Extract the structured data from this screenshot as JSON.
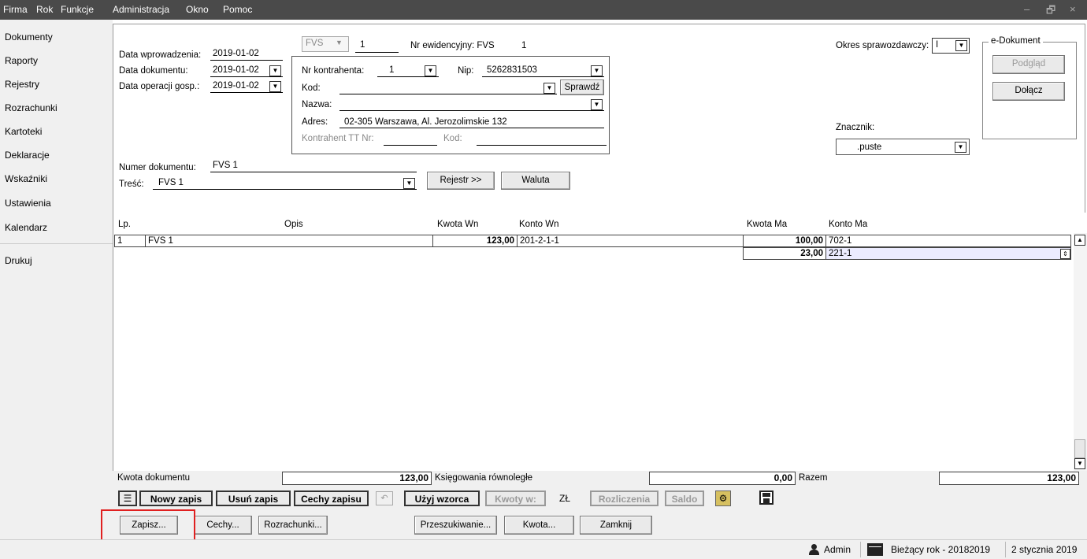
{
  "menu": [
    "Firma",
    "Rok",
    "Funkcje",
    "Administracja",
    "Okno",
    "Pomoc"
  ],
  "window_controls": {
    "minimize": "–",
    "restore": "🗗",
    "close": "×"
  },
  "sidebar": [
    "Dokumenty",
    "Raporty",
    "Rejestry",
    "Rozrachunki",
    "Kartoteki",
    "Deklaracje",
    "Wskaźniki",
    "Ustawienia",
    "Kalendarz",
    "Drukuj"
  ],
  "header": {
    "data_wprowadzenia_label": "Data wprowadzenia:",
    "data_wprowadzenia": "2019-01-02",
    "data_dokumentu_label": "Data dokumentu:",
    "data_dokumentu": "2019-01-02",
    "data_operacji_label": "Data operacji gosp.:",
    "data_operacji": "2019-01-02",
    "doc_type": "FVS",
    "doc_no": "1",
    "nr_ewid_label": "Nr ewidencyjny: FVS",
    "nr_ewid": "1",
    "okres_label": "Okres sprawozdawczy:",
    "okres": "I",
    "nr_kontrahenta_label": "Nr kontrahenta:",
    "nr_kontrahenta": "1",
    "nip_label": "Nip:",
    "nip": "5262831503",
    "kod_label": "Kod:",
    "sprawdz": "Sprawdź",
    "nazwa_label": "Nazwa:",
    "adres_label": "Adres:",
    "adres": "02-305 Warszawa, Al. Jerozolimskie 132",
    "kontrahent_tt_label": "Kontrahent TT Nr:",
    "kod2_label": "Kod:",
    "numer_dok_label": "Numer dokumentu:",
    "numer_dok": "FVS 1",
    "tresc_label": "Treść:",
    "tresc": "FVS 1",
    "rejestr_btn": "Rejestr >>",
    "waluta_btn": "Waluta",
    "znacznik_label": "Znacznik:",
    "znacznik": ".puste",
    "edok_label": "e-Dokument",
    "podglad": "Podgląd",
    "dolacz": "Dołącz"
  },
  "grid": {
    "headers": {
      "lp": "Lp.",
      "opis": "Opis",
      "kwota_wn": "Kwota Wn",
      "konto_wn": "Konto Wn",
      "kwota_ma": "Kwota Ma",
      "konto_ma": "Konto Ma"
    },
    "rows": [
      {
        "lp": "1",
        "opis": "FVS 1",
        "kwota_wn": "123,00",
        "konto_wn": "201-2-1-1",
        "kwota_ma": "100,00",
        "konto_ma": "702-1"
      },
      {
        "lp": "",
        "opis": "",
        "kwota_wn": "",
        "konto_wn": "",
        "kwota_ma": "23,00",
        "konto_ma": "221-1"
      }
    ]
  },
  "totals": {
    "kwota_dok_label": "Kwota dokumentu",
    "kwota_dok": "123,00",
    "ksieg_label": "Księgowania równoległe",
    "ksieg": "0,00",
    "razem_label": "Razem",
    "razem": "123,00"
  },
  "toolbar": {
    "nowy": "Nowy zapis",
    "usun": "Usuń zapis",
    "cechy_zapisu": "Cechy zapisu",
    "uzyj": "Użyj wzorca",
    "kwoty": "Kwoty w:",
    "zl": "ZŁ",
    "rozliczenia": "Rozliczenia",
    "saldo": "Saldo"
  },
  "bottom": {
    "zapisz": "Zapisz...",
    "cechy": "Cechy...",
    "rozrachunki": "Rozrachunki...",
    "przeszukiwanie": "Przeszukiwanie...",
    "kwota": "Kwota...",
    "zamknij": "Zamknij"
  },
  "status": {
    "user": "Admin",
    "rok": "Bieżący rok - 20182019",
    "date": "2 stycznia 2019"
  }
}
